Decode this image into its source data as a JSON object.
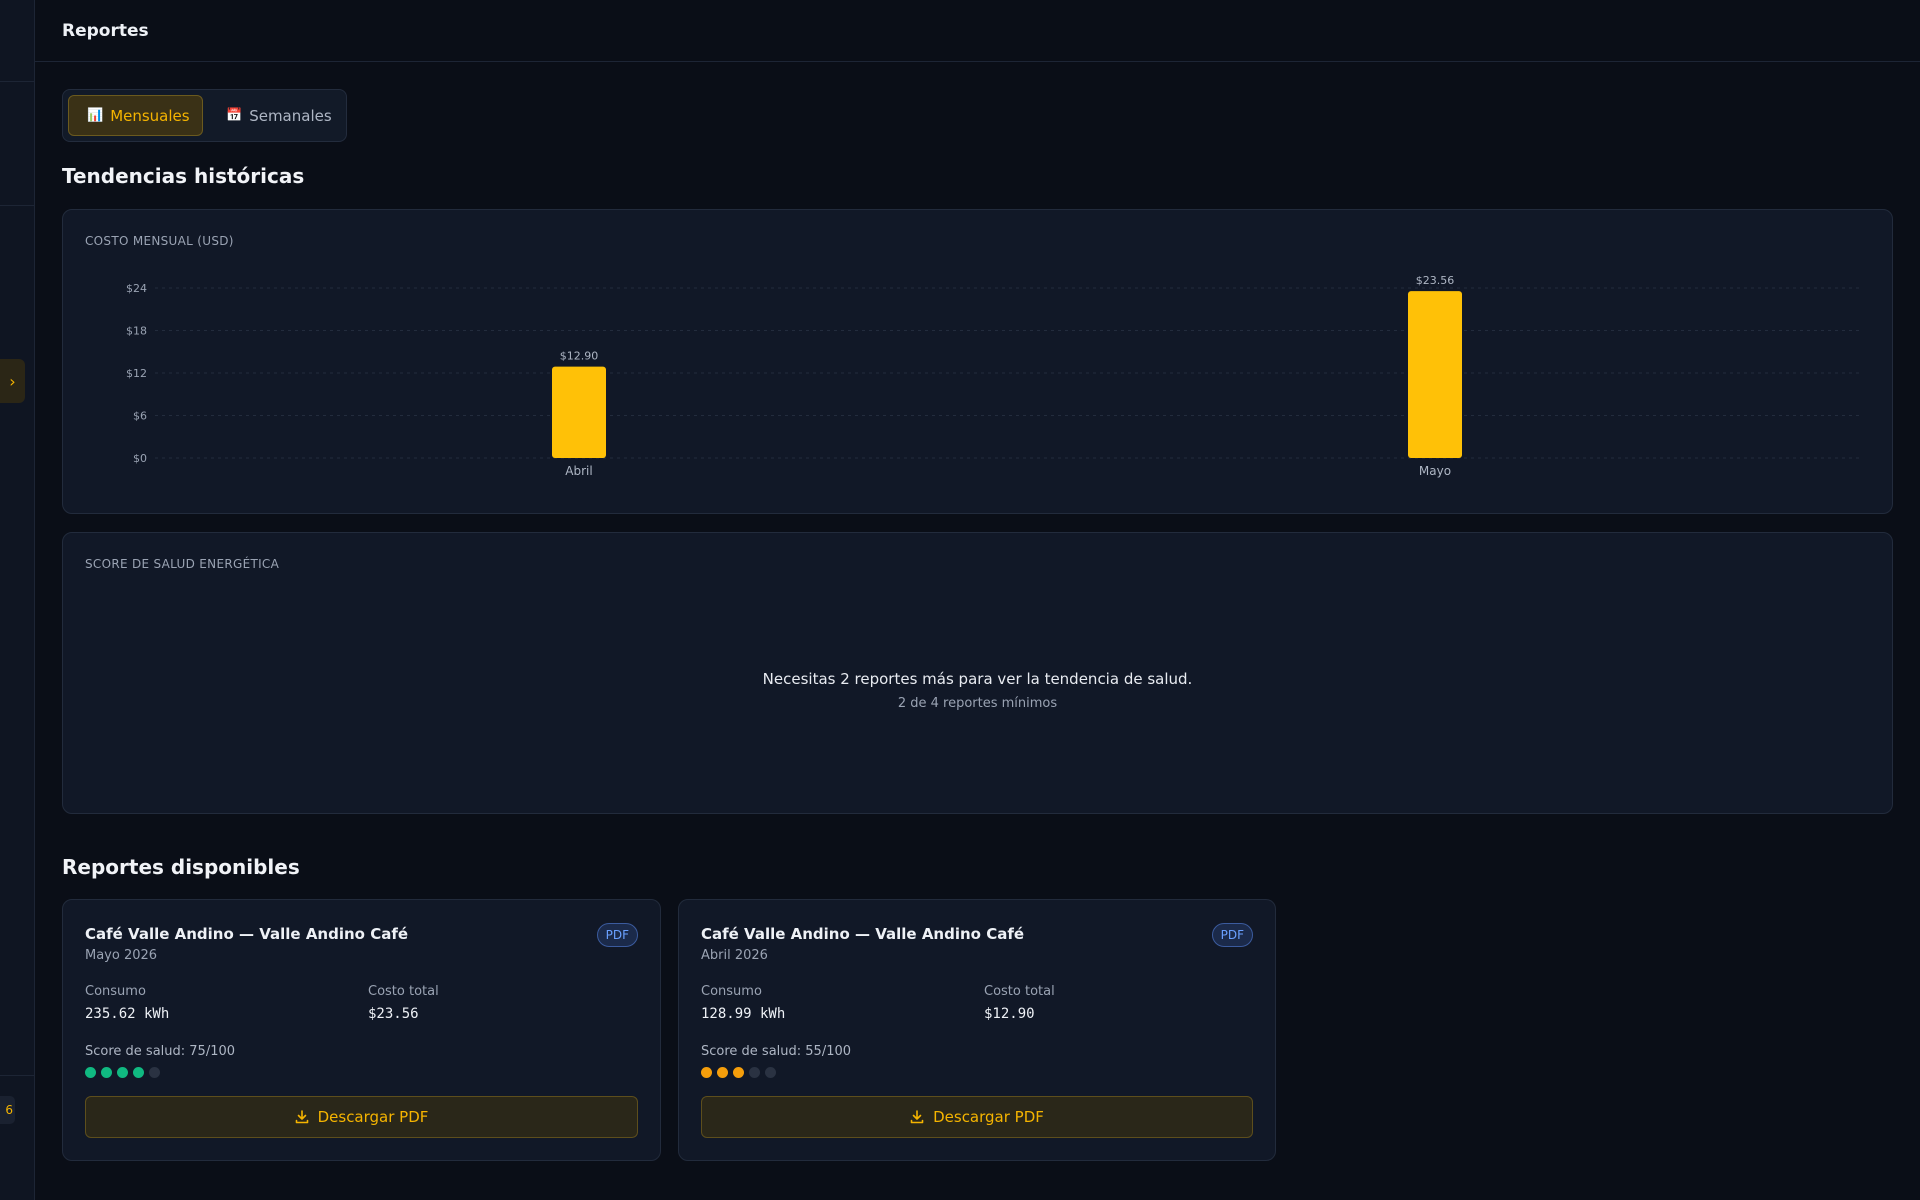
{
  "header": {
    "title": "Reportes"
  },
  "sidebar": {
    "toggle_icon": "chevron-right-icon",
    "badge_text": "6"
  },
  "tabs": [
    {
      "label": "Mensuales",
      "icon": "bar-chart-icon",
      "active": true
    },
    {
      "label": "Semanales",
      "icon": "calendar-icon",
      "active": false
    }
  ],
  "trends": {
    "title": "Tendencias históricas",
    "cost_chart_label": "COSTO MENSUAL (USD)",
    "health_chart_label": "SCORE DE SALUD ENERGÉTICA",
    "health_empty_message": "Necesitas 2 reportes más para ver la tendencia de salud.",
    "health_empty_sub": "2 de 4 reportes mínimos"
  },
  "chart_data": {
    "type": "bar",
    "title": "COSTO MENSUAL (USD)",
    "categories": [
      "Abril",
      "Mayo"
    ],
    "values": [
      12.9,
      23.56
    ],
    "data_labels": [
      "$12.90",
      "$23.56"
    ],
    "yticks": [
      "$0",
      "$6",
      "$12",
      "$18",
      "$24"
    ],
    "ylim": [
      0,
      24
    ],
    "grid": true,
    "color": "#ffc107"
  },
  "reports": {
    "title": "Reportes disponibles",
    "items": [
      {
        "title": "Café Valle Andino — Valle Andino Café",
        "period": "Mayo 2026",
        "badge": "PDF",
        "consumption_label": "Consumo",
        "consumption_value": "235.62 kWh",
        "cost_label": "Costo total",
        "cost_value": "$23.56",
        "score_text": "Score de salud: 75/100",
        "score_dots": 4,
        "score_color": "#10b981",
        "download_label": "Descargar PDF"
      },
      {
        "title": "Café Valle Andino — Valle Andino Café",
        "period": "Abril 2026",
        "badge": "PDF",
        "consumption_label": "Consumo",
        "consumption_value": "128.99 kWh",
        "cost_label": "Costo total",
        "cost_value": "$12.90",
        "score_text": "Score de salud: 55/100",
        "score_dots": 3,
        "score_color": "#f59e0b",
        "download_label": "Descargar PDF"
      }
    ]
  }
}
